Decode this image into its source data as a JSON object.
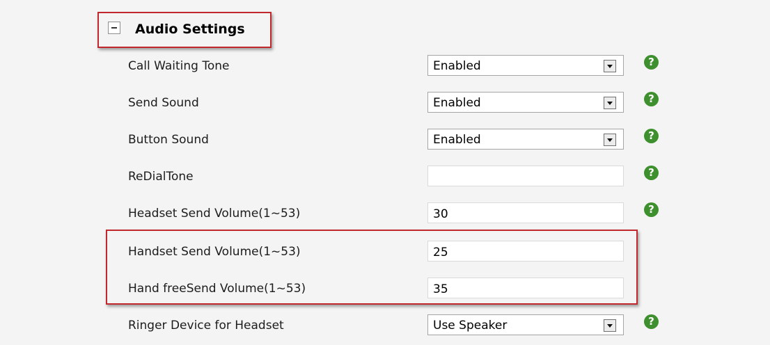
{
  "section": {
    "title": "Audio Settings",
    "expanded": true,
    "accent_color": "#c0282d"
  },
  "rows": [
    {
      "label": "Call Waiting Tone",
      "type": "select",
      "value": "Enabled",
      "help": true
    },
    {
      "label": "Send Sound",
      "type": "select",
      "value": "Enabled",
      "help": true
    },
    {
      "label": "Button Sound",
      "type": "select",
      "value": "Enabled",
      "help": true
    },
    {
      "label": "ReDialTone",
      "type": "text",
      "value": "",
      "help": true
    },
    {
      "label": "Headset Send Volume(1~53)",
      "type": "text",
      "value": "30",
      "help": true
    },
    {
      "label": "Handset Send Volume(1~53)",
      "type": "text",
      "value": "25",
      "help": false
    },
    {
      "label": "Hand freeSend Volume(1~53)",
      "type": "text",
      "value": "35",
      "help": false
    },
    {
      "label": "Ringer Device for Headset",
      "type": "select",
      "value": "Use Speaker",
      "help": true
    }
  ],
  "help_icon": {
    "glyph": "?",
    "icon": "help-icon",
    "color": "#3e8f2d"
  }
}
